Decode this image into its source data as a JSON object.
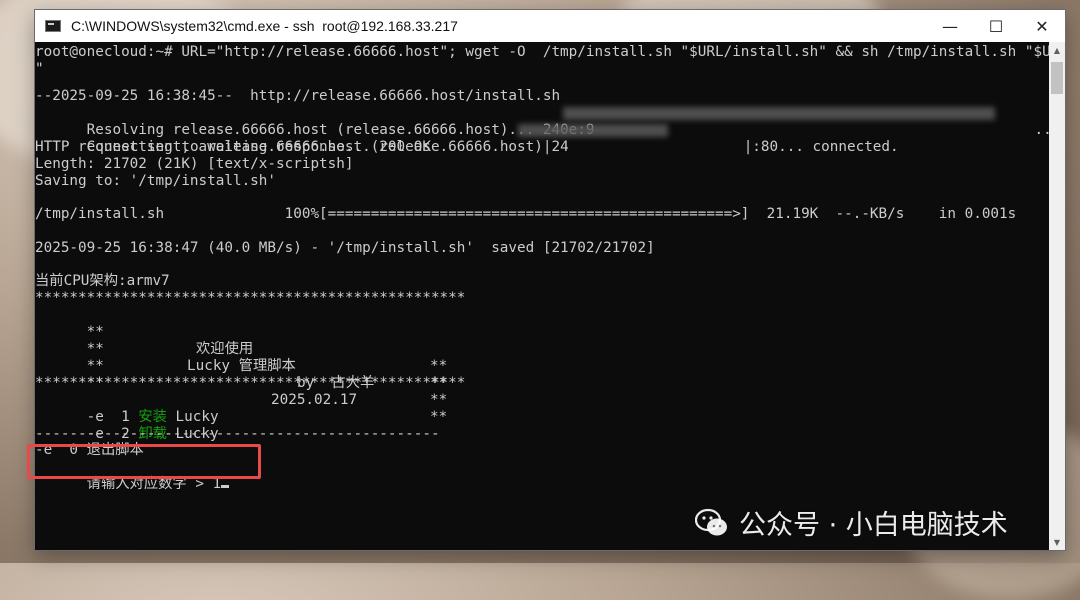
{
  "window": {
    "title": "C:\\WINDOWS\\system32\\cmd.exe - ssh  root@192.168.33.217",
    "minimize_glyph": "—",
    "maximize_glyph": "☐",
    "close_glyph": "✕"
  },
  "terminal": {
    "l01": "root@onecloud:~# URL=\"http://release.66666.host\"; wget -O  /tmp/install.sh \"$URL/install.sh\" && sh /tmp/install.sh \"$URL",
    "l02": "\"",
    "l03": "--2025-09-25 16:38:45--  http://release.66666.host/install.sh",
    "l04_a": "Resolving release.66666.host (release.66666.host)... 240e:9",
    "l04_b": "...",
    "l05_a": "Connecting to release.66666.host (release.66666.host)|24",
    "l05_b": "|:80... connected.",
    "l06": "HTTP request sent, awaiting response... 200 OK",
    "l07": "Length: 21702 (21K) [text/x-scriptsh]",
    "l08": "Saving to: '/tmp/install.sh'",
    "l09": "/tmp/install.sh              100%[===============================================>]  21.19K  --.-KB/s    in 0.001s",
    "l10": "2025-09-25 16:38:47 (40.0 MB/s) - '/tmp/install.sh'  saved [21702/21702]",
    "l11": "当前CPU架构:armv7",
    "l12": "**************************************************",
    "l13_a": "**",
    "l13_b": "欢迎使用",
    "l13_c": "**",
    "l14_a": "**",
    "l14_b": "Lucky 管理脚本",
    "l14_c": "**",
    "l15_a": "**",
    "l15_b": "by  古大羊",
    "l15_c": "**",
    "l16_a": "**",
    "l16_b": "2025.02.17",
    "l16_c": "**",
    "l17": "**************************************************",
    "l18_a": "-e  1 ",
    "l18_b": "安装",
    "l18_c": " Lucky",
    "l19_a": "-e  2 ",
    "l19_b": "卸载",
    "l19_c": " Lucky",
    "l20": "-----------------------------------------------",
    "l21": "-e  0 退出脚本",
    "l22": "请输入对应数字 > 1"
  },
  "watermark": {
    "text": "公众号 · 小白电脑技术"
  },
  "colors": {
    "terminal_bg": "#0c0c0c",
    "terminal_fg": "#cccccc",
    "menu_green": "#13a10e",
    "highlight_red": "#e84a4a"
  },
  "icons": [
    "cmd-app-icon",
    "minimize-icon",
    "maximize-icon",
    "close-icon",
    "wechat-icon"
  ]
}
